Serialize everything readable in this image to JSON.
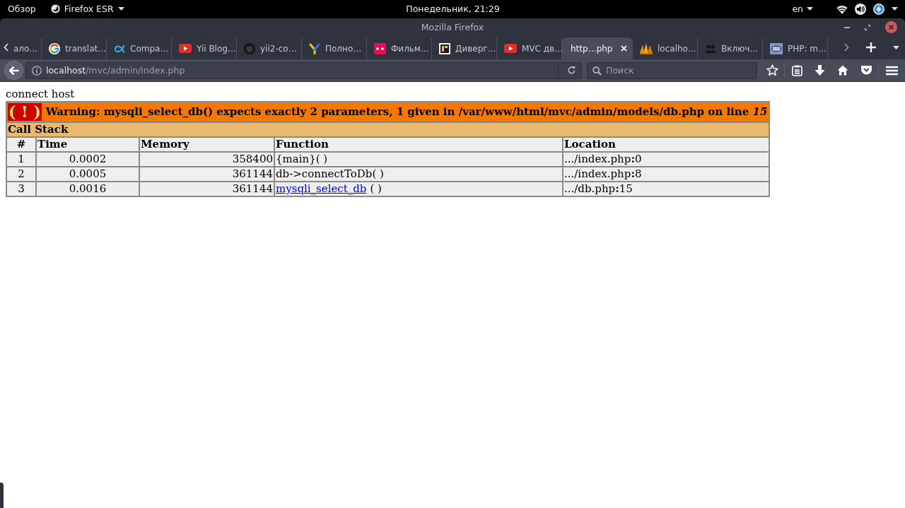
{
  "top_bar": {
    "activities": "Обзор",
    "app_menu": "Firefox ESR",
    "clock": "Понедельник, 21:29",
    "keyboard_layout": "en"
  },
  "window": {
    "title": "Mozilla Firefox"
  },
  "tabs": [
    {
      "title": "ало…",
      "selected": false
    },
    {
      "title": "translat…",
      "selected": false
    },
    {
      "title": "Compa…",
      "selected": false
    },
    {
      "title": "Yii Blog…",
      "selected": false
    },
    {
      "title": "yii2-co…",
      "selected": false
    },
    {
      "title": "Полно…",
      "selected": false
    },
    {
      "title": "Фильм…",
      "selected": false
    },
    {
      "title": "Диверг…",
      "selected": false
    },
    {
      "title": "MVC дв…",
      "selected": false
    },
    {
      "title": "http…php",
      "selected": true
    },
    {
      "title": "localho…",
      "selected": false
    },
    {
      "title": "Включ…",
      "selected": false
    },
    {
      "title": "PHP: m…",
      "selected": false
    }
  ],
  "toolbar": {
    "address": {
      "host": "localhost",
      "path": "/mvc/admin/index.php"
    },
    "search": {
      "placeholder": "Поиск"
    }
  },
  "page": {
    "output": "connect host",
    "error": {
      "sign": "( ! )",
      "message": "Warning: mysqli_select_db() expects exactly 2 parameters, 1 given in /var/www/html/mvc/admin/models/db.php on line *15*",
      "call_stack_title": "Call Stack",
      "columns": [
        "#",
        "Time",
        "Memory",
        "Function",
        "Location"
      ],
      "rows": [
        {
          "number": "1",
          "time": "0.0002",
          "memory": "358400",
          "function": {
            "kind": "text",
            "text": "{main}( )"
          },
          "location": ".../index.php**:**0"
        },
        {
          "number": "2",
          "time": "0.0005",
          "memory": "361144",
          "function": {
            "kind": "text",
            "text": "db->connectToDb( )"
          },
          "location": ".../index.php**:**8"
        },
        {
          "number": "3",
          "time": "0.0016",
          "memory": "361144",
          "function": {
            "kind": "link",
            "text": "mysqli_select_db",
            "suffix": "( )"
          },
          "location": ".../db.php**:**15"
        }
      ]
    }
  }
}
